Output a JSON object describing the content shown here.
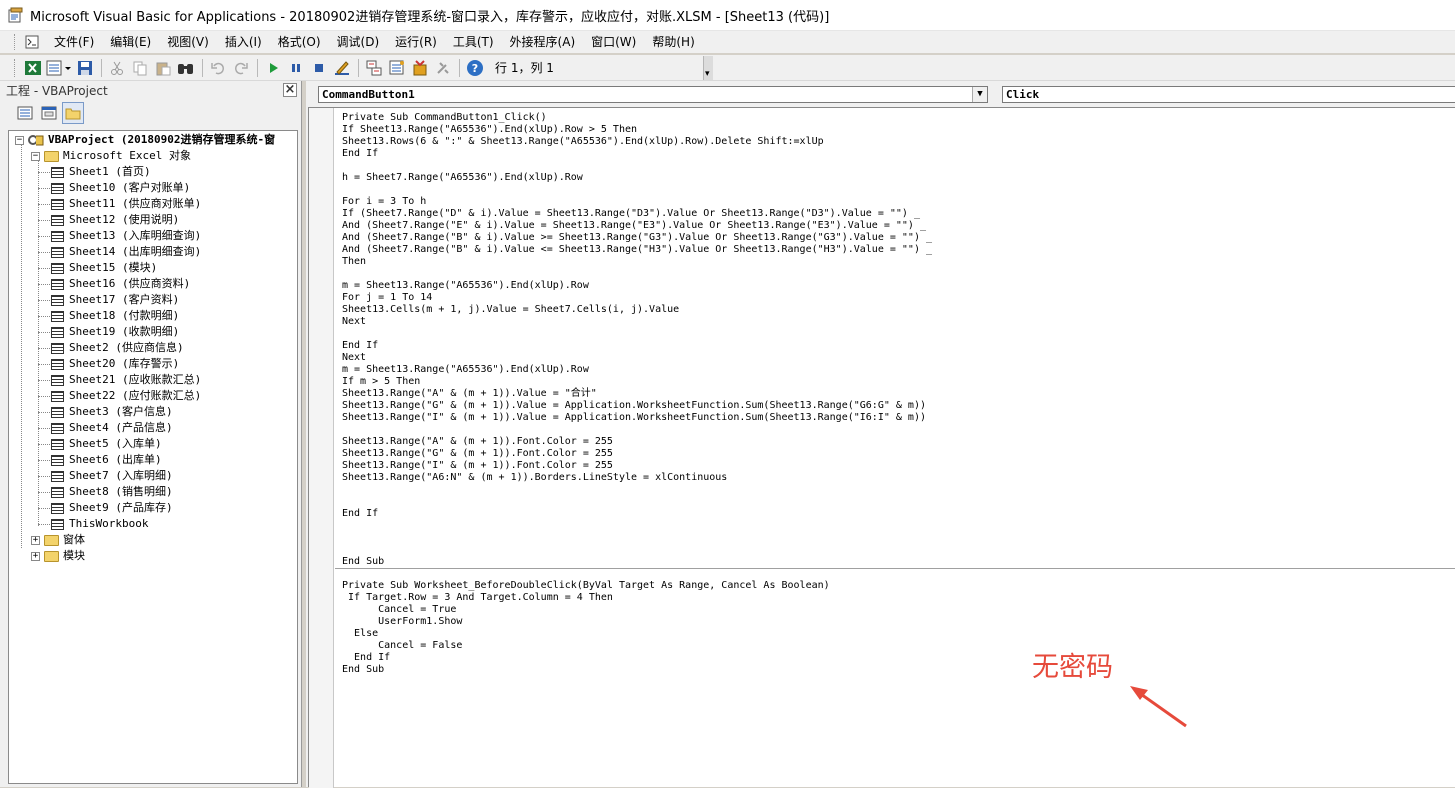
{
  "window": {
    "title": "Microsoft Visual Basic for Applications - 20180902进销存管理系统-窗口录入，库存警示，应收应付，对账.XLSM - [Sheet13 (代码)]"
  },
  "menu": {
    "items": [
      "文件(F)",
      "编辑(E)",
      "视图(V)",
      "插入(I)",
      "格式(O)",
      "调试(D)",
      "运行(R)",
      "工具(T)",
      "外接程序(A)",
      "窗口(W)",
      "帮助(H)"
    ]
  },
  "toolbar": {
    "position_text": "行 1，列 1",
    "icons": [
      "excel-icon",
      "insert-module-icon",
      "save-icon",
      "cut-icon",
      "copy-icon",
      "paste-icon",
      "find-icon",
      "undo-icon",
      "redo-icon",
      "run-icon",
      "pause-icon",
      "reset-icon",
      "design-mode-icon",
      "project-explorer-icon",
      "properties-icon",
      "object-browser-icon",
      "toolbox-icon",
      "help-icon"
    ]
  },
  "project": {
    "header": "工程 - VBAProject",
    "root_label": "VBAProject (20180902进销存管理系统-窗",
    "excel_objects_label": "Microsoft Excel 对象",
    "sheets": [
      "Sheet1 (首页)",
      "Sheet10 (客户对账单)",
      "Sheet11 (供应商对账单)",
      "Sheet12 (使用说明)",
      "Sheet13 (入库明细查询)",
      "Sheet14 (出库明细查询)",
      "Sheet15 (模块)",
      "Sheet16 (供应商资料)",
      "Sheet17 (客户资料)",
      "Sheet18 (付款明细)",
      "Sheet19 (收款明细)",
      "Sheet2 (供应商信息)",
      "Sheet20 (库存警示)",
      "Sheet21 (应收账款汇总)",
      "Sheet22 (应付账款汇总)",
      "Sheet3 (客户信息)",
      "Sheet4 (产品信息)",
      "Sheet5 (入库单)",
      "Sheet6 (出库单)",
      "Sheet7 (入库明细)",
      "Sheet8 (销售明细)",
      "Sheet9 (产品库存)",
      "ThisWorkbook"
    ],
    "forms_label": "窗体",
    "modules_label": "模块"
  },
  "code": {
    "object_combo": "CommandButton1",
    "procedure_combo": "Click",
    "proc1": "Private Sub CommandButton1_Click()\nIf Sheet13.Range(\"A65536\").End(xlUp).Row > 5 Then\nSheet13.Rows(6 & \":\" & Sheet13.Range(\"A65536\").End(xlUp).Row).Delete Shift:=xlUp\nEnd If\n\nh = Sheet7.Range(\"A65536\").End(xlUp).Row\n\nFor i = 3 To h\nIf (Sheet7.Range(\"D\" & i).Value = Sheet13.Range(\"D3\").Value Or Sheet13.Range(\"D3\").Value = \"\") _\nAnd (Sheet7.Range(\"E\" & i).Value = Sheet13.Range(\"E3\").Value Or Sheet13.Range(\"E3\").Value = \"\") _\nAnd (Sheet7.Range(\"B\" & i).Value >= Sheet13.Range(\"G3\").Value Or Sheet13.Range(\"G3\").Value = \"\") _\nAnd (Sheet7.Range(\"B\" & i).Value <= Sheet13.Range(\"H3\").Value Or Sheet13.Range(\"H3\").Value = \"\") _\nThen\n\nm = Sheet13.Range(\"A65536\").End(xlUp).Row\nFor j = 1 To 14\nSheet13.Cells(m + 1, j).Value = Sheet7.Cells(i, j).Value\nNext\n\nEnd If\nNext\nm = Sheet13.Range(\"A65536\").End(xlUp).Row\nIf m > 5 Then\nSheet13.Range(\"A\" & (m + 1)).Value = \"合计\"\nSheet13.Range(\"G\" & (m + 1)).Value = Application.WorksheetFunction.Sum(Sheet13.Range(\"G6:G\" & m))\nSheet13.Range(\"I\" & (m + 1)).Value = Application.WorksheetFunction.Sum(Sheet13.Range(\"I6:I\" & m))\n\nSheet13.Range(\"A\" & (m + 1)).Font.Color = 255\nSheet13.Range(\"G\" & (m + 1)).Font.Color = 255\nSheet13.Range(\"I\" & (m + 1)).Font.Color = 255\nSheet13.Range(\"A6:N\" & (m + 1)).Borders.LineStyle = xlContinuous\n\n\nEnd If\n\n\n\nEnd Sub",
    "proc2": "Private Sub Worksheet_BeforeDoubleClick(ByVal Target As Range, Cancel As Boolean)\n If Target.Row = 3 And Target.Column = 4 Then\n      Cancel = True\n      UserForm1.Show\n  Else\n      Cancel = False\n  End If\nEnd Sub"
  },
  "annotation": {
    "text": "无密码",
    "color": "#e64a3b"
  }
}
